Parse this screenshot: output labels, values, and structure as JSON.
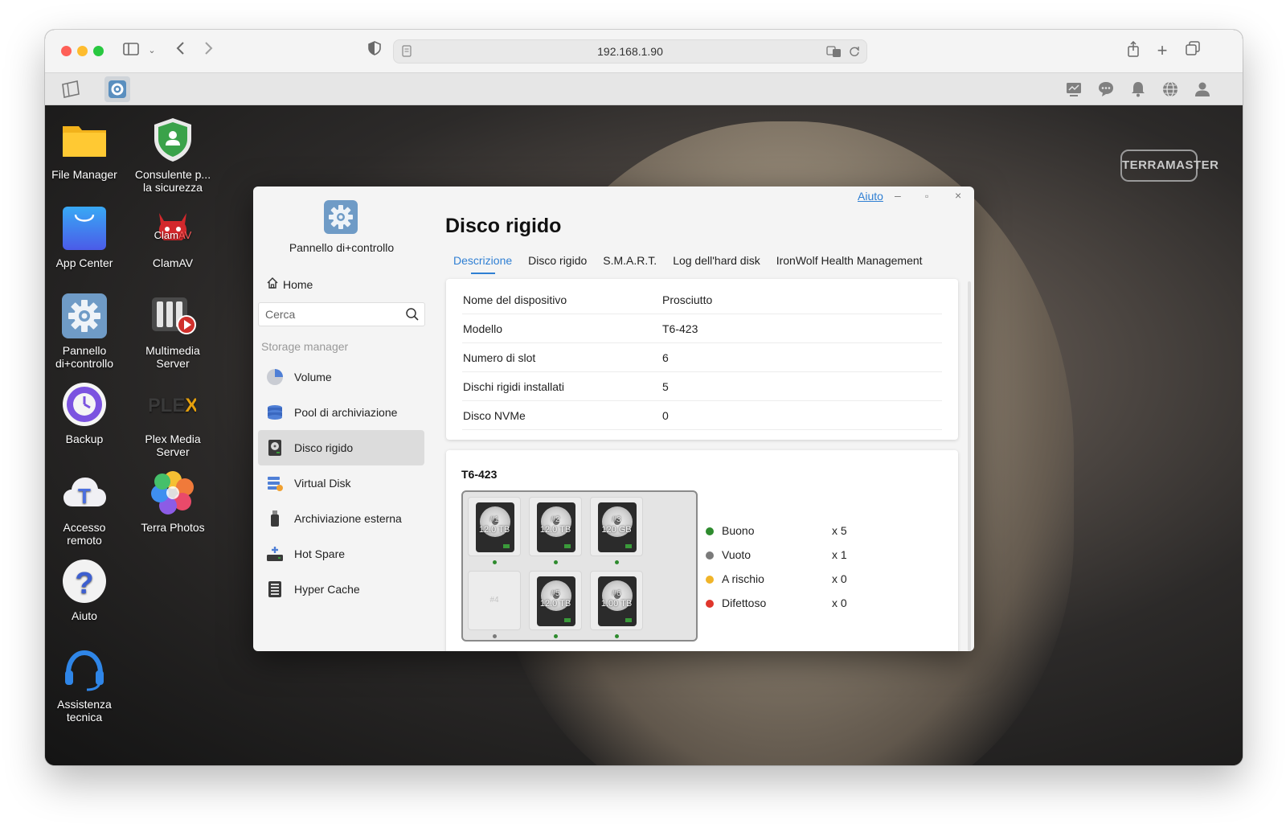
{
  "browser": {
    "url": "192.168.1.90"
  },
  "desktop": {
    "brand": "TERRAMASTER",
    "apps": [
      {
        "label": "File Manager",
        "icon": "folder-icon"
      },
      {
        "label": "Consulente p...\nla sicurezza",
        "icon": "security-advisor-icon"
      },
      {
        "label": "App Center",
        "icon": "shopping-bag-icon"
      },
      {
        "label": "ClamAV",
        "icon": "clamav-icon"
      },
      {
        "label": "Pannello\ndi+controllo",
        "icon": "gear-icon"
      },
      {
        "label": "Multimedia\nServer",
        "icon": "multimedia-server-icon"
      },
      {
        "label": "Backup",
        "icon": "backup-clock-icon"
      },
      {
        "label": "Plex Media\nServer",
        "icon": "plex-icon"
      },
      {
        "label": "Accesso\nremoto",
        "icon": "cloud-icon"
      },
      {
        "label": "Terra Photos",
        "icon": "flower-icon"
      },
      {
        "label": "Aiuto",
        "icon": "help-icon"
      },
      {
        "label": "Assistenza\ntecnica",
        "icon": "headset-icon"
      }
    ]
  },
  "panel": {
    "help_link": "Aiuto",
    "sidebar": {
      "title": "Pannello di+controllo",
      "home": "Home",
      "search_placeholder": "Cerca",
      "section": "Storage manager",
      "items": [
        {
          "label": "Volume",
          "icon": "volume-pie-icon"
        },
        {
          "label": "Pool di archiviazione",
          "icon": "storage-pool-icon"
        },
        {
          "label": "Disco rigido",
          "icon": "hard-disk-icon"
        },
        {
          "label": "Virtual Disk",
          "icon": "virtual-disk-icon"
        },
        {
          "label": "Archiviazione esterna",
          "icon": "usb-drive-icon"
        },
        {
          "label": "Hot Spare",
          "icon": "hot-spare-icon"
        },
        {
          "label": "Hyper Cache",
          "icon": "hyper-cache-icon"
        }
      ]
    },
    "title": "Disco rigido",
    "tabs": [
      "Descrizione",
      "Disco rigido",
      "S.M.A.R.T.",
      "Log dell'hard disk",
      "IronWolf Health Management"
    ],
    "info": [
      {
        "key": "Nome del dispositivo",
        "value": "Prosciutto"
      },
      {
        "key": "Modello",
        "value": "T6-423"
      },
      {
        "key": "Numero di slot",
        "value": "6"
      },
      {
        "key": "Dischi rigidi installati",
        "value": "5"
      },
      {
        "key": "Disco NVMe",
        "value": "0"
      }
    ],
    "enclosure": {
      "model": "T6-423",
      "slots": [
        {
          "num": "#1",
          "capacity": "12.0 TB",
          "status": "good"
        },
        {
          "num": "#2",
          "capacity": "12.0 TB",
          "status": "good"
        },
        {
          "num": "#3",
          "capacity": "120 GB",
          "status": "good"
        },
        {
          "num": "#4",
          "capacity": "",
          "status": "empty"
        },
        {
          "num": "#5",
          "capacity": "12.0 TB",
          "status": "good"
        },
        {
          "num": "#6",
          "capacity": "1.00 TB",
          "status": "good"
        }
      ]
    },
    "legend": [
      {
        "name": "Buono",
        "count": "x 5",
        "color": "#2e8b2e"
      },
      {
        "name": "Vuoto",
        "count": "x 1",
        "color": "#7a7a7a"
      },
      {
        "name": "A rischio",
        "count": "x 0",
        "color": "#f0b429"
      },
      {
        "name": "Difettoso",
        "count": "x 0",
        "color": "#e0362c"
      }
    ]
  }
}
